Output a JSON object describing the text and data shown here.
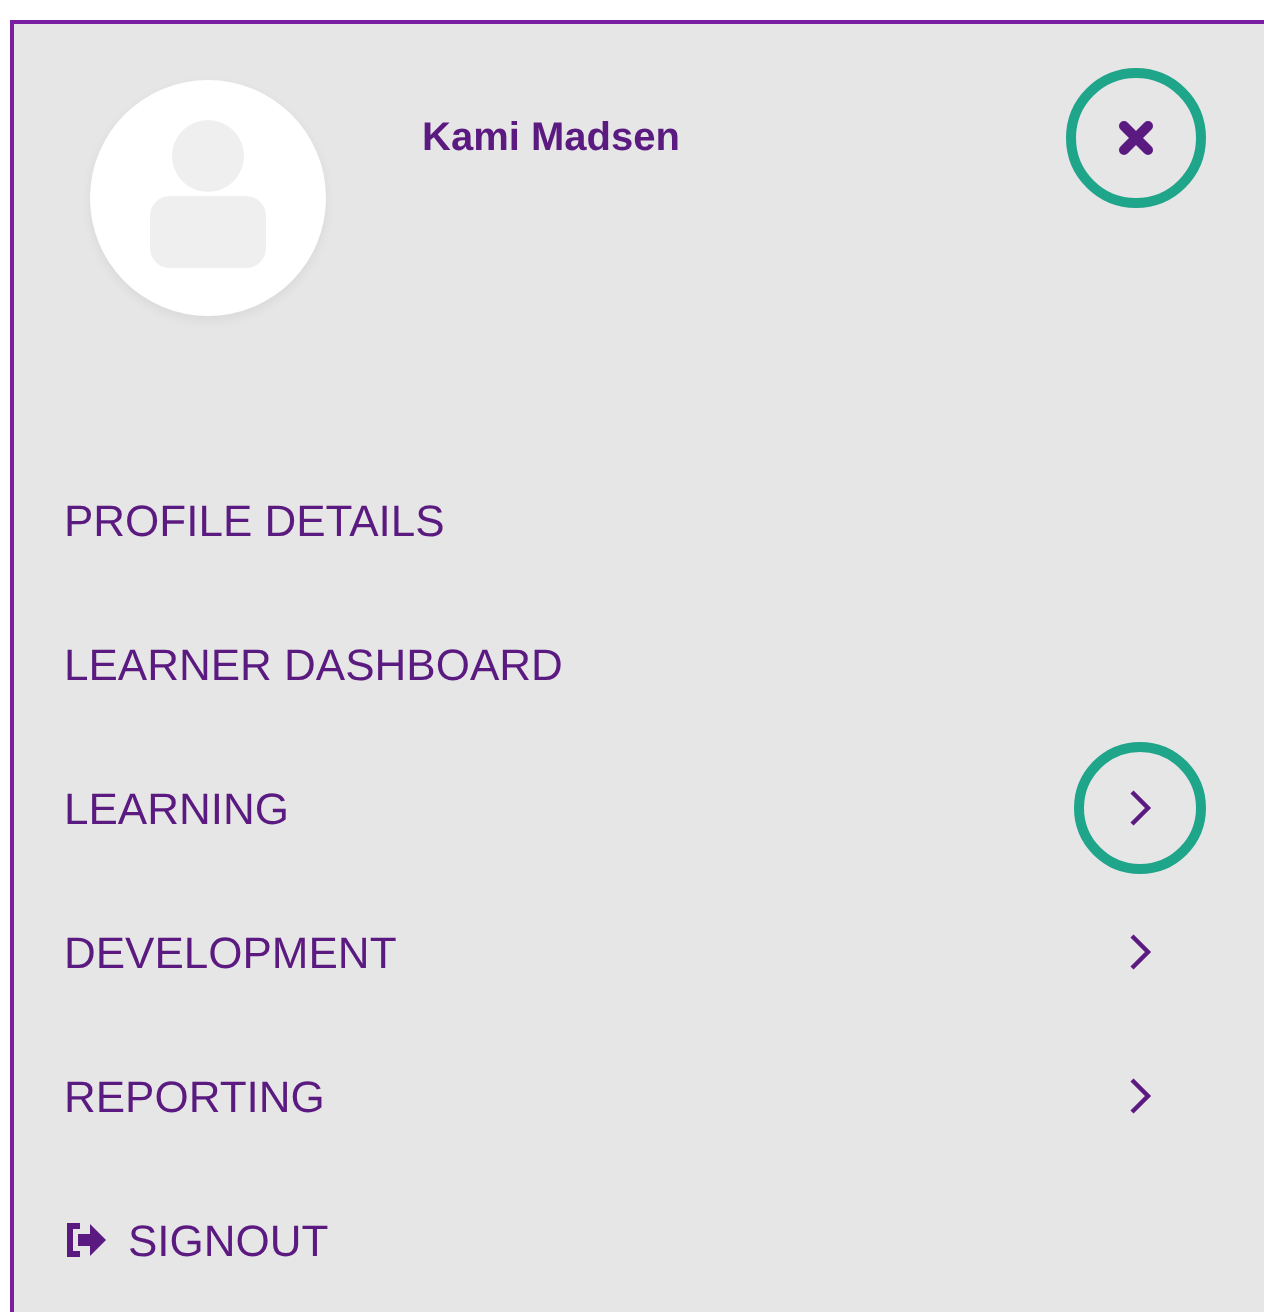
{
  "profile": {
    "name": "Kami Madsen"
  },
  "close_button": {
    "highlighted": true
  },
  "menu": [
    {
      "label": "PROFILE DETAILS",
      "kind": "link",
      "highlighted": false
    },
    {
      "label": "LEARNER DASHBOARD",
      "kind": "link",
      "highlighted": false
    },
    {
      "label": "LEARNING",
      "kind": "submenu",
      "highlighted": true
    },
    {
      "label": "DEVELOPMENT",
      "kind": "submenu",
      "highlighted": false
    },
    {
      "label": "REPORTING",
      "kind": "submenu",
      "highlighted": false
    },
    {
      "label": "SIGNOUT",
      "kind": "signout",
      "highlighted": false
    }
  ]
}
